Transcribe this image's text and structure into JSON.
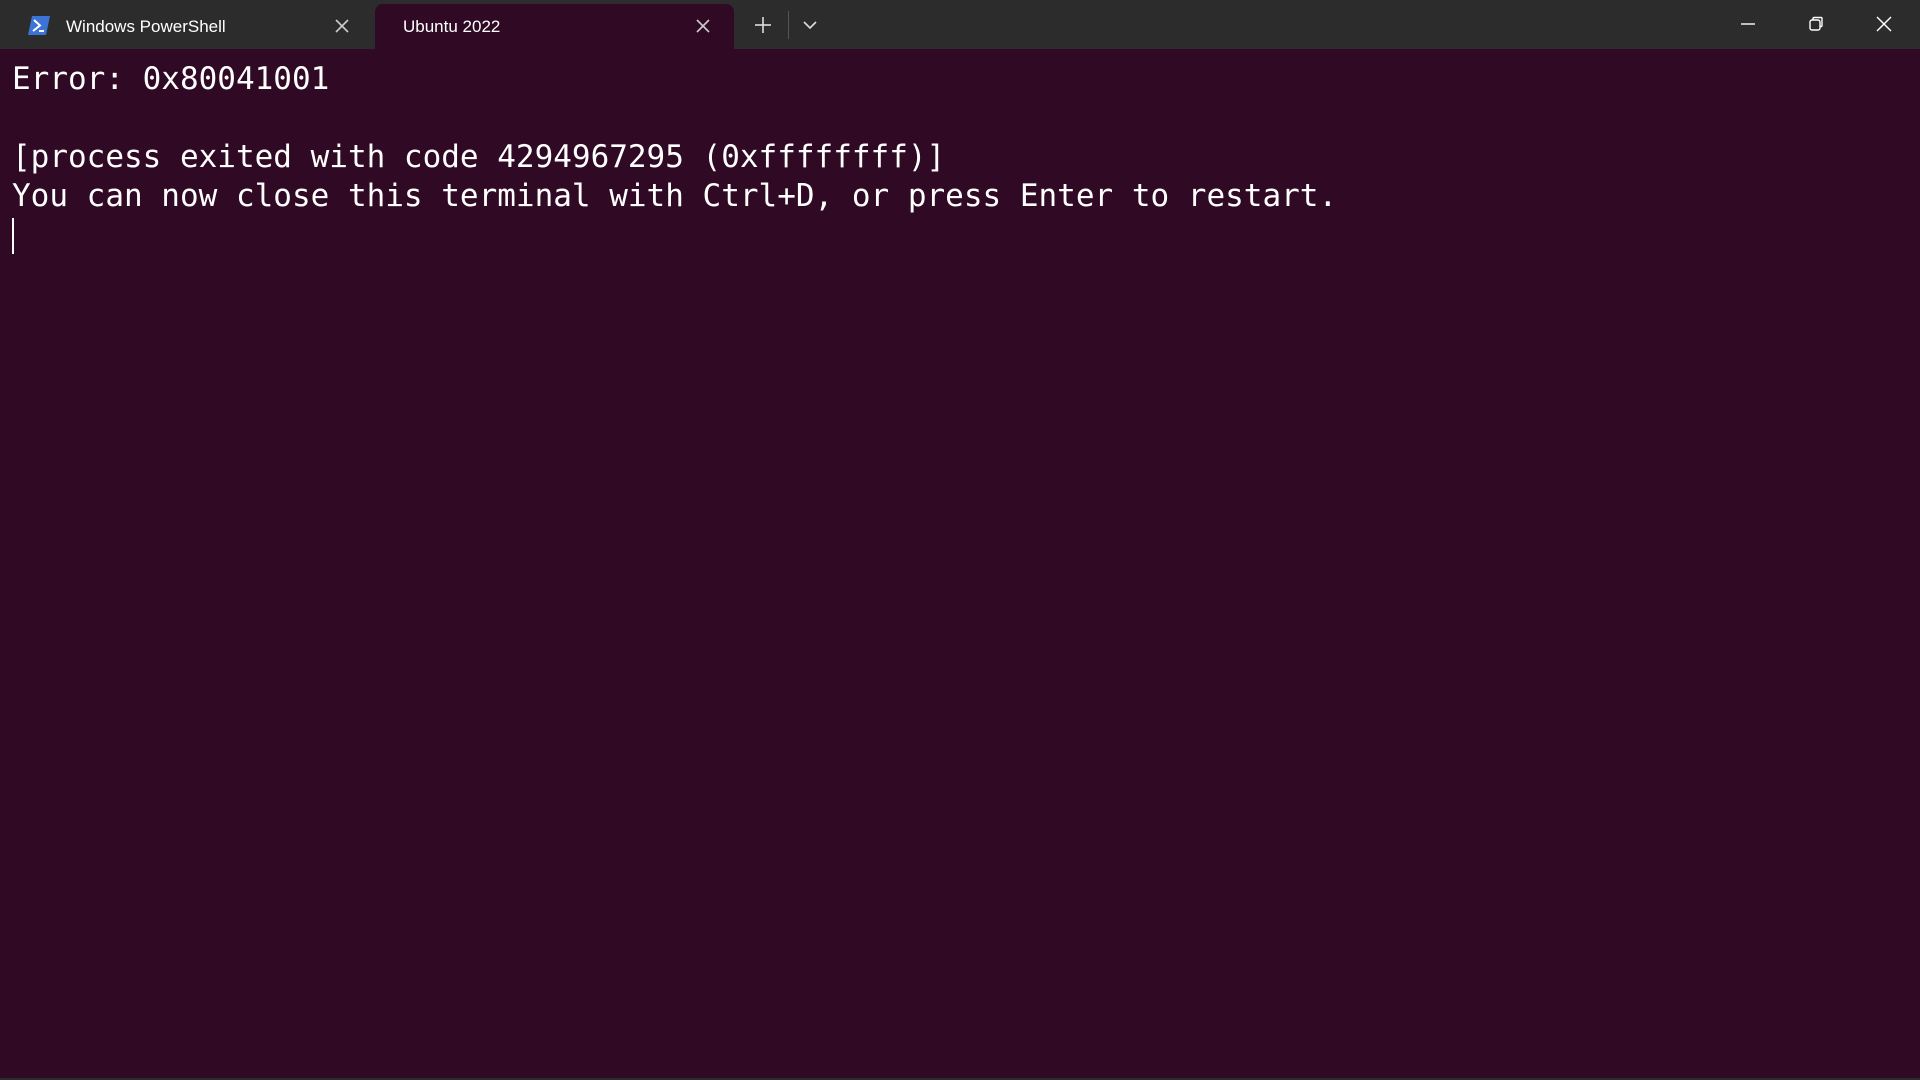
{
  "tabs": [
    {
      "label": "Windows PowerShell",
      "icon": "powershell-icon",
      "active": false
    },
    {
      "label": "Ubuntu 2022",
      "icon": null,
      "active": true
    }
  ],
  "terminal": {
    "lines": [
      "Error: 0x80041001",
      "",
      "[process exited with code 4294967295 (0xffffffff)]",
      "You can now close this terminal with Ctrl+D, or press Enter to restart."
    ]
  },
  "colors": {
    "titlebar": "#2c2c2c",
    "terminal_background": "#300a24",
    "text": "#ffffff",
    "powershell_icon": "#3b74d4"
  }
}
